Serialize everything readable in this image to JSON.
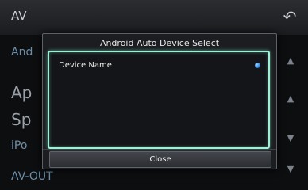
{
  "header": {
    "title": "AV",
    "back_icon": "back-arrow-icon"
  },
  "background_rows": {
    "android": "And",
    "ap": "Ap",
    "sp": "Sp",
    "ipod": "iPo",
    "avout": "AV-OUT"
  },
  "dialog": {
    "title": "Android Auto Device Select",
    "devices": [
      {
        "name": "Device Name",
        "selected": true
      }
    ],
    "close_label": "Close"
  },
  "colors": {
    "focus_border": "#9ef1d6",
    "selected_dot": "#2f7fd8",
    "background_text": "#6d8ea8"
  }
}
